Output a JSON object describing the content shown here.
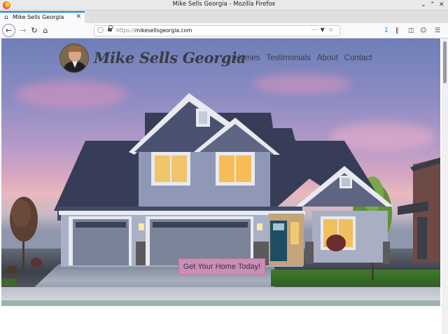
{
  "window": {
    "title": "Mike Sells Georgia - Mozilla Firefox"
  },
  "tab": {
    "label": "Mike Sells Georgia"
  },
  "urlbar": {
    "protocol": "https://",
    "host": "mikesellsgeorgia.com"
  },
  "site": {
    "brand": "Mike Sells Georgia",
    "nav": [
      "Homes",
      "Testimonials",
      "About",
      "Contact"
    ],
    "cta": "Get Your Home Today!"
  },
  "colors": {
    "accent": "#0a84ff",
    "cta_bg": "#c98fb4",
    "brand_text": "#3a3a45"
  }
}
